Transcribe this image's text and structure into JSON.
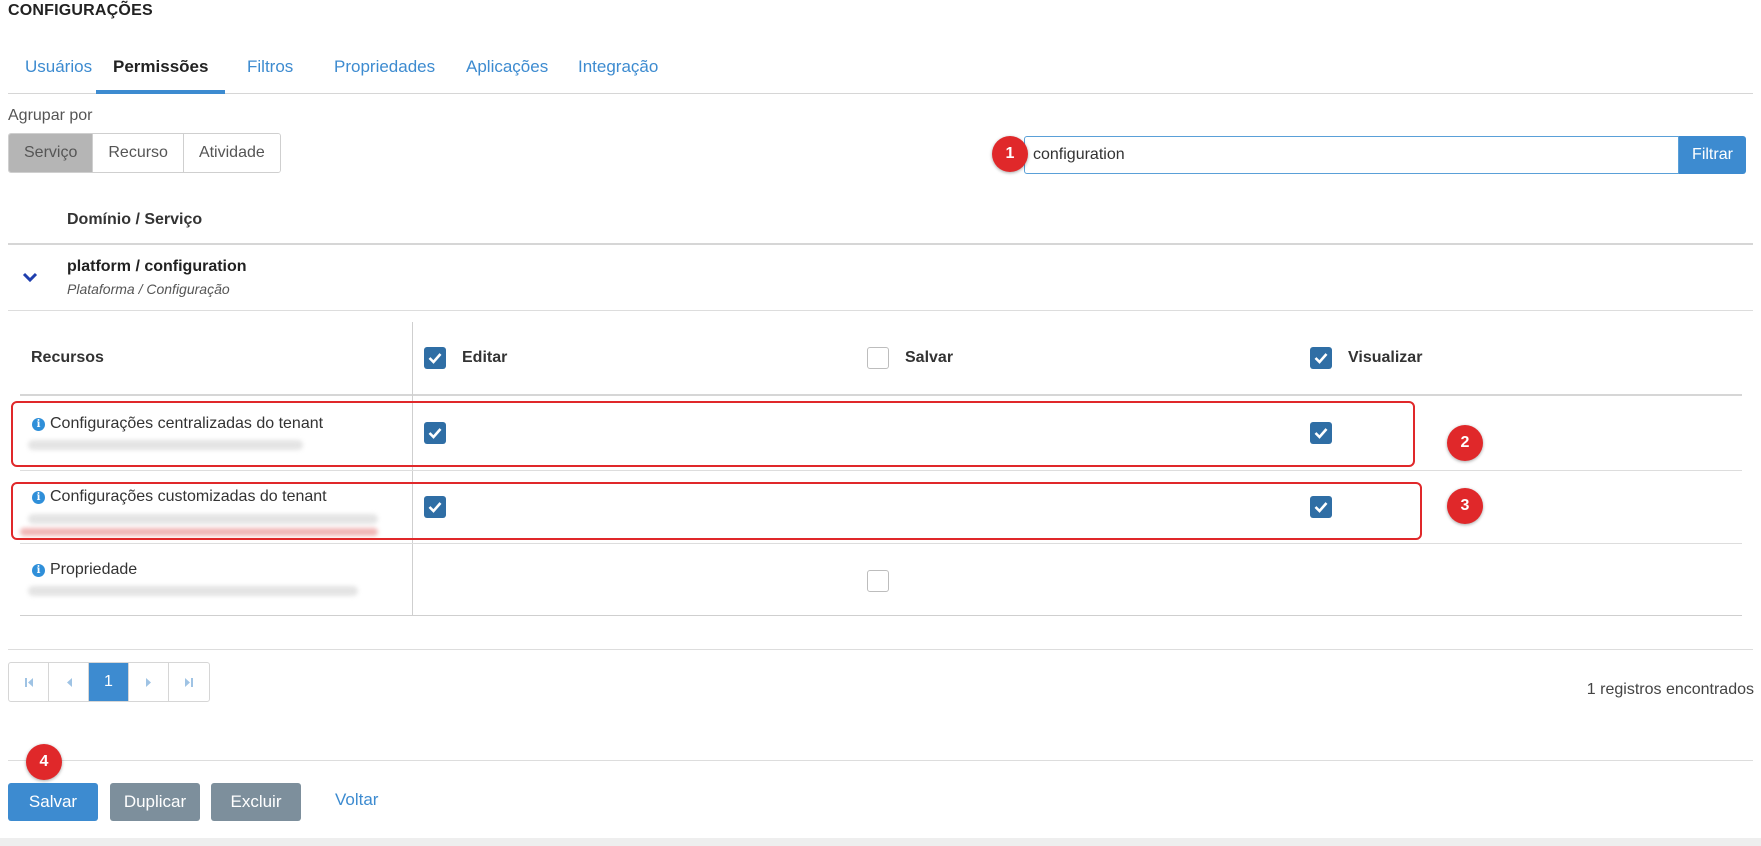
{
  "page": {
    "title": "CONFIGURAÇÕES"
  },
  "tabs": [
    {
      "label": "Usuários",
      "active": false
    },
    {
      "label": "Permissões",
      "active": true
    },
    {
      "label": "Filtros",
      "active": false
    },
    {
      "label": "Propriedades",
      "active": false
    },
    {
      "label": "Aplicações",
      "active": false
    },
    {
      "label": "Integração",
      "active": false
    }
  ],
  "group_by": {
    "label": "Agrupar por",
    "options": [
      "Serviço",
      "Recurso",
      "Atividade"
    ],
    "selected": "Serviço"
  },
  "search": {
    "value": "configuration",
    "button_label": "Filtrar"
  },
  "table": {
    "column_header": "Domínio / Serviço",
    "domain": {
      "title": "platform / configuration",
      "subtitle": "Plataforma / Configuração",
      "expanded": true
    },
    "permissions": {
      "resources_header": "Recursos",
      "columns": [
        {
          "label": "Editar",
          "checked": true
        },
        {
          "label": "Salvar",
          "checked": false
        },
        {
          "label": "Visualizar",
          "checked": true
        }
      ],
      "rows": [
        {
          "name": "Configurações centralizadas do tenant",
          "editar": true,
          "salvar": null,
          "visualizar": true
        },
        {
          "name": "Configurações customizadas do tenant",
          "editar": true,
          "salvar": null,
          "visualizar": true
        },
        {
          "name": "Propriedade",
          "editar": null,
          "salvar": false,
          "visualizar": null
        }
      ]
    }
  },
  "pagination": {
    "current_page": "1",
    "records_text": "1 registros encontrados"
  },
  "actions": {
    "save": "Salvar",
    "duplicate": "Duplicar",
    "delete": "Excluir",
    "back": "Voltar"
  },
  "markers": [
    "1",
    "2",
    "3",
    "4"
  ],
  "colors": {
    "accent": "#3d8bd0",
    "checkbox": "#2f6ea5",
    "marker": "#e0282a",
    "gray_button": "#7d8f9c"
  }
}
